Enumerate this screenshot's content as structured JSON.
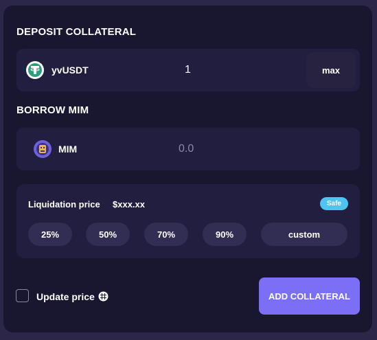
{
  "deposit": {
    "title": "DEPOSIT COLLATERAL",
    "token_icon": "tether-usdt-icon",
    "token_name": "yvUSDT",
    "amount": "1",
    "max_label": "max"
  },
  "borrow": {
    "title": "BORROW MIM",
    "token_icon": "mim-icon",
    "token_name": "MIM",
    "amount_placeholder": "0.0"
  },
  "liquidation": {
    "label": "Liquidation price",
    "value": "$xxx.xx",
    "status": "Safe",
    "status_color": "#4ec4f0",
    "options": [
      "25%",
      "50%",
      "70%",
      "90%",
      "custom"
    ]
  },
  "footer": {
    "update_price_label": "Update price",
    "update_price_checked": false,
    "info_icon": "info-icon",
    "submit_label": "ADD COLLATERAL",
    "submit_color": "#7b6ff5"
  }
}
